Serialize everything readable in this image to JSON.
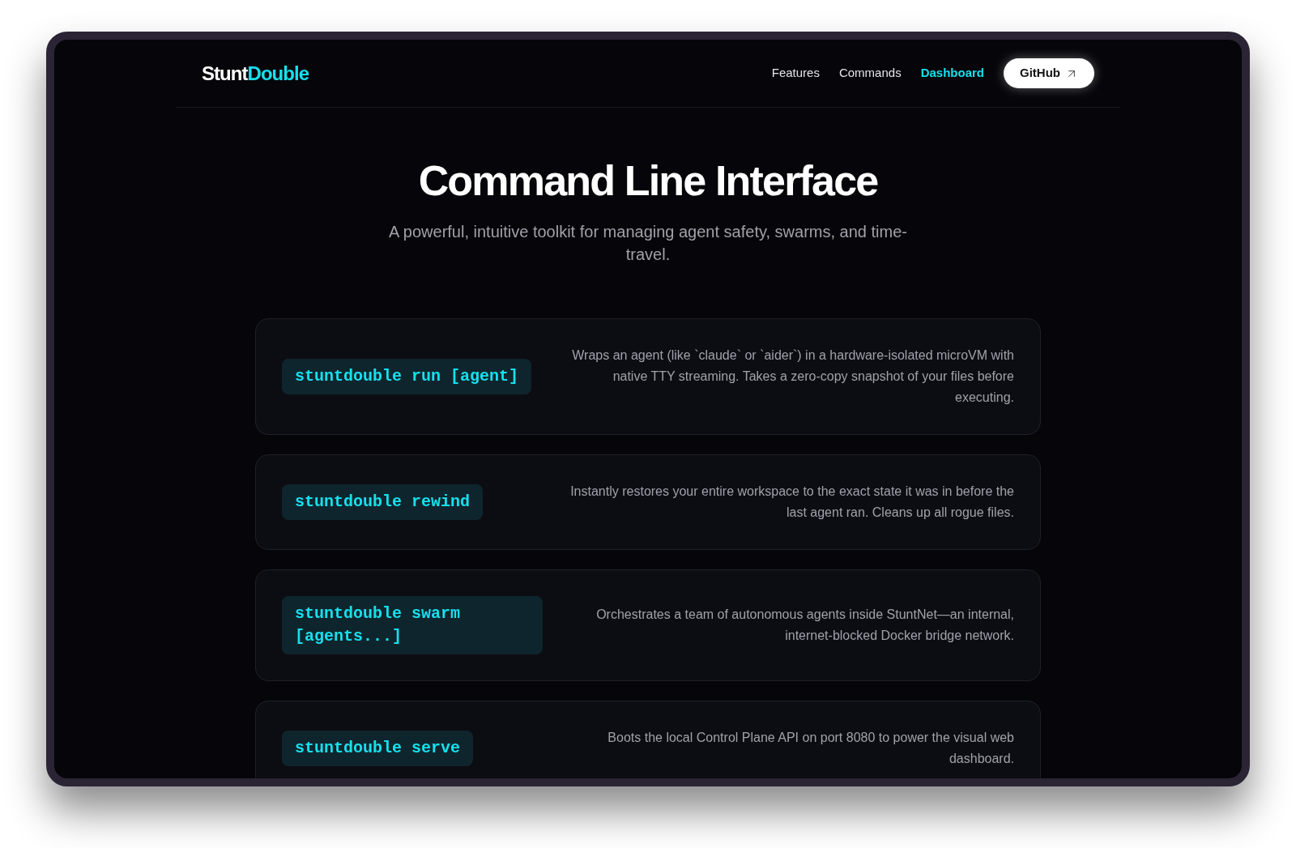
{
  "nav": {
    "logo": {
      "part_1": "Stunt",
      "part_2": "Double"
    },
    "links": [
      {
        "label": "Features",
        "selected": false
      },
      {
        "label": "Commands",
        "selected": false
      },
      {
        "label": "Dashboard",
        "selected": true
      }
    ],
    "github_button": {
      "label": "GitHub"
    }
  },
  "hero": {
    "title": "Command Line Interface",
    "subtitle": "A powerful, intuitive toolkit for managing agent safety, swarms, and time-travel."
  },
  "commands": [
    {
      "command": "stuntdouble run [agent]",
      "description": "Wraps an agent (like `claude` or `aider`) in a hardware-isolated microVM with native TTY streaming. Takes a zero-copy snapshot of your files before executing."
    },
    {
      "command": "stuntdouble rewind",
      "description": "Instantly restores your entire workspace to the exact state it was in before the last agent ran. Cleans up all rogue files."
    },
    {
      "command": "stuntdouble swarm [agents...]",
      "description": "Orchestrates a team of autonomous agents inside StuntNet—an internal, internet-blocked Docker bridge network."
    },
    {
      "command": "stuntdouble serve",
      "description": "Boots the local Control Plane API on port 8080 to power the visual web dashboard."
    }
  ]
}
